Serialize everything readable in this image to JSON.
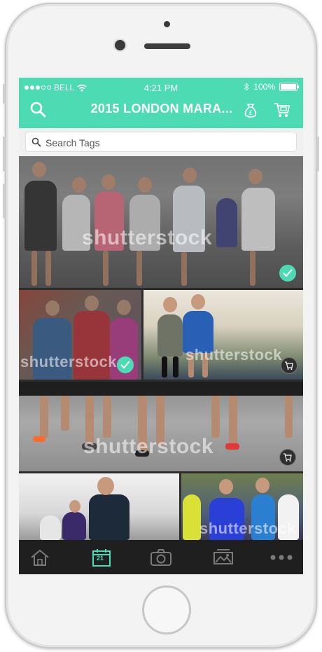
{
  "status_bar": {
    "carrier": "BELL",
    "time": "4:21 PM",
    "battery": "100%"
  },
  "header": {
    "title": "2015 LONDON MARA...",
    "left_icon": "search-icon",
    "right_icons": [
      "money-bag-icon",
      "cart-icon"
    ]
  },
  "search": {
    "placeholder": "Search Tags"
  },
  "photos": [
    {
      "watermark": "shutterstock",
      "selected": true,
      "badge": "check-icon"
    },
    {
      "watermark": "shutterstock",
      "selected": true,
      "badge": "check-icon"
    },
    {
      "watermark": "shutterstock",
      "selected": false,
      "badge": "cart-icon"
    },
    {
      "watermark": "shutterstock",
      "selected": false,
      "badge": "cart-icon"
    },
    {
      "watermark": "",
      "selected": false
    },
    {
      "watermark": "shutterstock",
      "selected": false
    }
  ],
  "tabbar": {
    "tabs": [
      {
        "name": "home-icon",
        "active": false
      },
      {
        "name": "calendar-icon",
        "label": "21",
        "active": true
      },
      {
        "name": "camera-icon",
        "active": false
      },
      {
        "name": "gallery-icon",
        "active": false
      },
      {
        "name": "more-icon",
        "active": false
      }
    ]
  },
  "colors": {
    "accent": "#4ddbb3",
    "tabbar": "#1f1f1f"
  }
}
